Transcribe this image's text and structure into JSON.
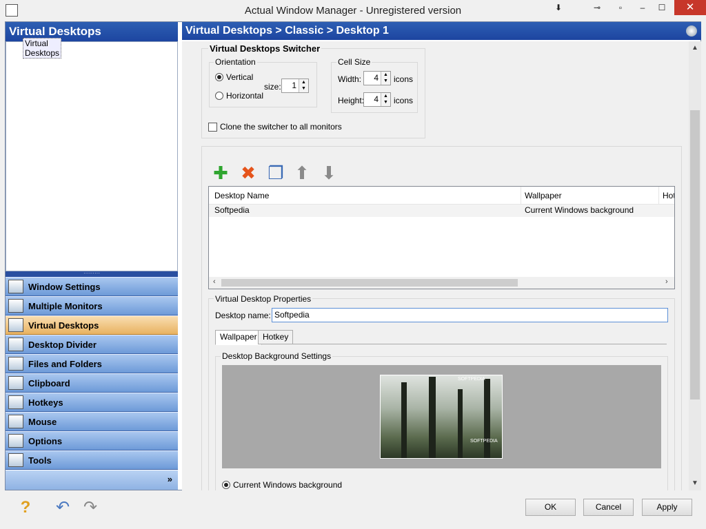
{
  "window": {
    "title": "Actual Window Manager - Unregistered version",
    "btn_down": "⬇",
    "btn_pin": "⊸",
    "btn_dot": "▫",
    "btn_min": "–",
    "btn_max": "☐",
    "btn_close": "✕"
  },
  "left_panel": {
    "header": "Virtual Desktops",
    "tree_item": "Virtual Desktops",
    "splitter_dots": "·········",
    "nav_items": [
      {
        "label": "Window Settings"
      },
      {
        "label": "Multiple Monitors"
      },
      {
        "label": "Virtual Desktops"
      },
      {
        "label": "Desktop Divider"
      },
      {
        "label": "Files and Folders"
      },
      {
        "label": "Clipboard"
      },
      {
        "label": "Hotkeys"
      },
      {
        "label": "Mouse"
      },
      {
        "label": "Options"
      },
      {
        "label": "Tools"
      }
    ],
    "more": "»"
  },
  "right_panel": {
    "breadcrumb": "Virtual Desktops > Classic > Desktop 1"
  },
  "switcher": {
    "title": "Virtual Desktops Switcher",
    "orientation_label": "Orientation",
    "vertical": "Vertical",
    "horizontal": "Horizontal",
    "size_label": "size:",
    "size_value": "1",
    "cell_size_label": "Cell Size",
    "width_label": "Width:",
    "width_value": "4",
    "height_label": "Height:",
    "height_value": "4",
    "icons_unit": "icons",
    "clone_label": "Clone the switcher to all monitors",
    "arrow_up": "▲",
    "arrow_down": "▼"
  },
  "toolbar": {
    "add": "✚",
    "delete": "✖",
    "copy": "❐",
    "up": "⬆",
    "down": "⬇"
  },
  "desktop_list": {
    "columns": [
      "Desktop Name",
      "Wallpaper",
      "Hot"
    ],
    "rows": [
      {
        "name": "Softpedia",
        "wallpaper": "Current Windows background"
      }
    ],
    "scroll_left": "‹",
    "scroll_right": "›"
  },
  "properties": {
    "group_label": "Virtual Desktop Properties",
    "name_label": "Desktop name:",
    "name_value": "Softpedia",
    "tabs": [
      "Wallpaper",
      "Hotkey"
    ],
    "bg_settings_label": "Desktop Background Settings",
    "preview_watermark_top": "SOFTPEDIA",
    "preview_watermark_mid": "SOFTPEDIA",
    "current_bg_label": "Current Windows background"
  },
  "scrollbar": {
    "up": "▲",
    "down": "▼"
  },
  "footer": {
    "help_icon": "?",
    "undo_icon": "↶",
    "redo_icon": "↷",
    "ok": "OK",
    "cancel": "Cancel",
    "apply": "Apply"
  }
}
